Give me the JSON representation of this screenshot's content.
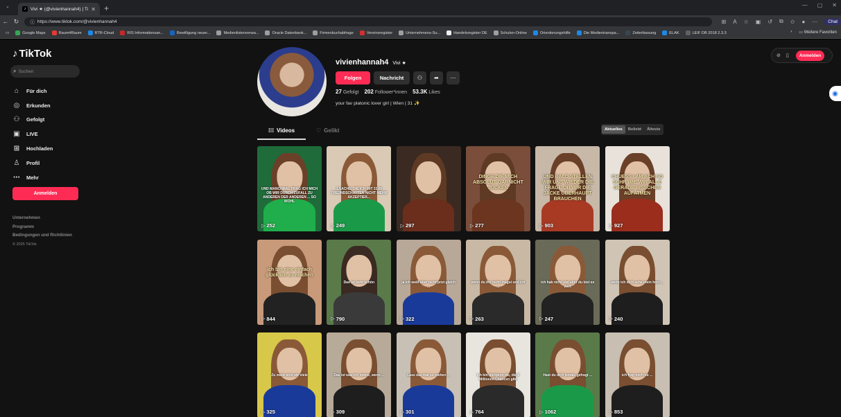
{
  "browser": {
    "tab_title": "Vivi ★ (@vivienhannah4) | TikTok",
    "url": "https://www.tiktok.com/@vivienhannah4",
    "bookmarks": [
      {
        "label": "Google Maps",
        "color": "#34a853"
      },
      {
        "label": "Raum4Raum",
        "color": "#e53935"
      },
      {
        "label": "RTR-Cloud",
        "color": "#1e88e5"
      },
      {
        "label": "RIS Informationsan...",
        "color": "#c62828"
      },
      {
        "label": "Bewilligung neuer...",
        "color": "#1565c0"
      },
      {
        "label": "Medienlistenverwa...",
        "color": "#9e9e9e"
      },
      {
        "label": "Oracle Datenbank...",
        "color": "#9e9e9e"
      },
      {
        "label": "Firmenbuchabfrage",
        "color": "#9e9e9e"
      },
      {
        "label": "Vereinsregister",
        "color": "#d32f2f"
      },
      {
        "label": "Unternehmens-Su...",
        "color": "#9e9e9e"
      },
      {
        "label": "Handelsregister DE",
        "color": "#eeeeee"
      },
      {
        "label": "Schulen-Online",
        "color": "#9e9e9e"
      },
      {
        "label": "Orientierungshilfe",
        "color": "#1e88e5"
      },
      {
        "label": "Die Medientranspa...",
        "color": "#1e88e5"
      },
      {
        "label": "Zeiterfassung",
        "color": "#37474f"
      },
      {
        "label": "ELAK",
        "color": "#1e88e5"
      },
      {
        "label": "LEIF DB 2018 2.3.3",
        "color": "#616161"
      }
    ],
    "more_favorites": "Weitere Favoriten",
    "chat_label": "Chat"
  },
  "sidebar": {
    "logo": "TikTok",
    "search_placeholder": "Suchen",
    "items": [
      {
        "label": "Für dich",
        "icon": "⌂"
      },
      {
        "label": "Erkunden",
        "icon": "◎"
      },
      {
        "label": "Gefolgt",
        "icon": "⚇"
      },
      {
        "label": "LIVE",
        "icon": "▣"
      },
      {
        "label": "Hochladen",
        "icon": "⊞"
      },
      {
        "label": "Profil",
        "icon": "♙"
      },
      {
        "label": "Mehr",
        "icon": "⋯"
      }
    ],
    "login": "Anmelden",
    "footer": [
      "Unternehmen",
      "Programm",
      "Bedingungen und Richtlinien"
    ],
    "copyright": "© 2025 TikTok"
  },
  "topbar": {
    "login": "Anmelden"
  },
  "profile": {
    "username": "vivienhannah4",
    "nickname": "Vivi ★",
    "follow": "Folgen",
    "message": "Nachricht",
    "following_count": "27",
    "following_label": "Gefolgt",
    "followers_count": "202",
    "followers_label": "Follower*innen",
    "likes_count": "53.3K",
    "likes_label": "Likes",
    "bio": "your fav platonic lover girl | Wien | 31 ✨"
  },
  "tabs": {
    "videos": "Videos",
    "liked": "Gelikt",
    "sort": [
      "Aktuelles",
      "Beliebt",
      "Älteste"
    ]
  },
  "videos": [
    {
      "views": "252",
      "caption": "UND MANCHMAL FRAG ICH MICH OB WIR DURCH ZUFALL ZU ANDEREN DER ANDEREN ... SO WOHL",
      "big": false,
      "bg": "#1f6b3a",
      "body": "#1fae4b",
      "hair": "#6b4028"
    },
    {
      "views": "249",
      "caption": "1 SACHE, DIE ICH MIT 31 IN FREUNDSCHAFTEN NICHT MEHR AKZEPTIER...",
      "big": false,
      "bg": "#d9c9b5",
      "body": "#1a9a48",
      "hair": "#8a5a38"
    },
    {
      "views": "297",
      "caption": "",
      "big": false,
      "bg": "#3a2a22",
      "body": "#6b2d1c",
      "hair": "#5e3a24"
    },
    {
      "views": "277",
      "caption": "DINGE DIE MICH ABSOLUT GARNICHT JUCKEN",
      "big": true,
      "bg": "#7a4e3a",
      "body": "#6b3520",
      "hair": "#5e3a24"
    },
    {
      "views": "903",
      "caption": "UND BALD STELLEN WIR UNS WIEDER DIE FRAGE OB WIR DIE JACKE ÜBERHAUPT BRAUCHEN",
      "big": true,
      "bg": "#c7b8a8",
      "body": "#a83a24",
      "hair": "#6b4028"
    },
    {
      "views": "927",
      "caption": "CHUESS I AM ACH SO SEHR WIE WIR ALLE GERADE BISSCHEN AUFATMEN",
      "big": true,
      "bg": "#e8e2da",
      "body": "#9a2d1c",
      "hair": "#6b4028"
    },
    {
      "views": "844",
      "caption": "ich bin eine einfach glücklich zu machen",
      "big": true,
      "bg": "#c89a7a",
      "body": "#222222",
      "hair": "#7a4e30"
    },
    {
      "views": "790",
      "caption": "Das ist sehr schön",
      "big": false,
      "bg": "#5a7a4a",
      "body": "#3a3a3a",
      "hair": "#3a2a22"
    },
    {
      "views": "322",
      "caption": "ja ich weiß aber nicht jetzt gleich ...",
      "big": false,
      "bg": "#b8a898",
      "body": "#1a3a9a",
      "hair": "#8a5a38"
    },
    {
      "views": "263",
      "caption": "wenn du ihn nicht magst und ich ...",
      "big": false,
      "bg": "#c8b8a4",
      "body": "#2a2a2a",
      "hair": "#8a5a38"
    },
    {
      "views": "247",
      "caption": "ich hab nicht viel aber du bist es wert",
      "big": false,
      "bg": "#6a6a58",
      "body": "#222222",
      "hair": "#8a5a38"
    },
    {
      "views": "240",
      "caption": "wenn ich dich sehe mein herz ...",
      "big": false,
      "bg": "#d0c4b4",
      "body": "#1e1e1e",
      "hair": "#7a4e30"
    },
    {
      "views": "325",
      "caption": "Zu zweit sind wir viele",
      "big": false,
      "bg": "#d8c84a",
      "body": "#1a3a9a",
      "hair": "#8a5a38"
    },
    {
      "views": "309",
      "caption": "Das ist was ich meine, wenn ...",
      "big": false,
      "bg": "#b8aa98",
      "body": "#1e1e1e",
      "hair": "#7a4e30"
    },
    {
      "views": "301",
      "caption": "Lass das mal so stehen ...",
      "big": false,
      "bg": "#c8c0b4",
      "body": "#1a3a9a",
      "hair": "#8a5a38"
    },
    {
      "views": "764",
      "caption": "ich bin übrigens die, die 8 Millionen Chancen gibt",
      "big": false,
      "bg": "#e8e4de",
      "body": "#2a2a2a",
      "hair": "#7a4e30"
    },
    {
      "views": "1062",
      "caption": "Hast du dich jemals gefragt ...",
      "big": false,
      "bg": "#5a7a4a",
      "body": "#1a9a48",
      "hair": "#7a4e30"
    },
    {
      "views": "853",
      "caption": "ich frag mich ob ...",
      "big": false,
      "bg": "#c8beb2",
      "body": "#1e1e1e",
      "hair": "#7a4e30"
    }
  ]
}
